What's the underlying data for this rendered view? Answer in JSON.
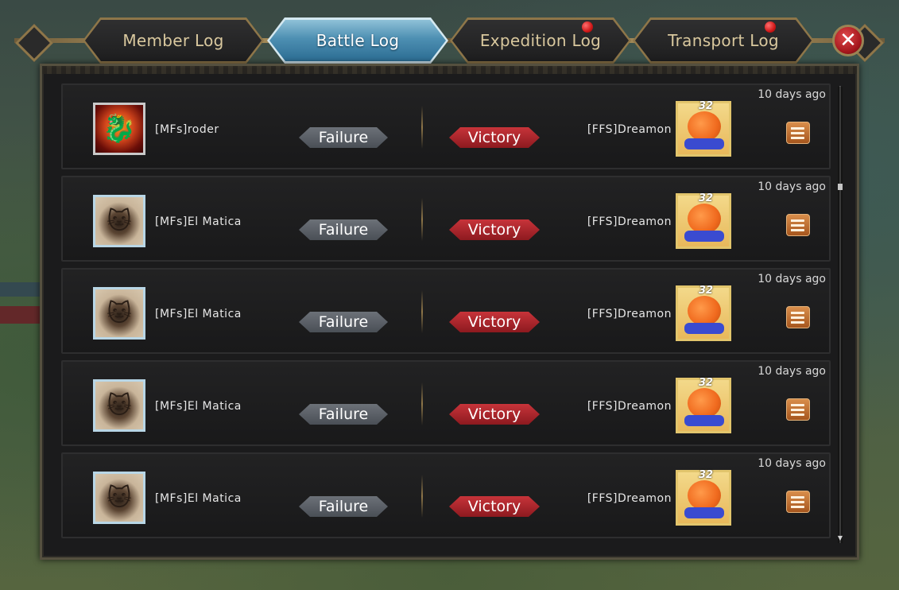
{
  "tabs": [
    {
      "label": "Member Log",
      "active": false,
      "has_notification": false
    },
    {
      "label": "Battle Log",
      "active": true,
      "has_notification": false
    },
    {
      "label": "Expedition Log",
      "active": false,
      "has_notification": true
    },
    {
      "label": "Transport Log",
      "active": false,
      "has_notification": true
    }
  ],
  "close_label": "✕",
  "colors": {
    "active_tab": "#4d8fb2",
    "victory": "#c7343a",
    "failure": "#5a5f66",
    "notification": "#d01818",
    "details_button": "#c1742f"
  },
  "battles": [
    {
      "attacker": "[MFs]roder",
      "attacker_avatar": "dragon",
      "attacker_result": "Failure",
      "defender_result": "Victory",
      "defender": "[FFS]Dreamon",
      "defender_level": "32",
      "time": "10 days ago"
    },
    {
      "attacker": "[MFs]El Matica",
      "attacker_avatar": "cat",
      "attacker_result": "Failure",
      "defender_result": "Victory",
      "defender": "[FFS]Dreamon",
      "defender_level": "32",
      "time": "10 days ago"
    },
    {
      "attacker": "[MFs]El Matica",
      "attacker_avatar": "cat",
      "attacker_result": "Failure",
      "defender_result": "Victory",
      "defender": "[FFS]Dreamon",
      "defender_level": "32",
      "time": "10 days ago"
    },
    {
      "attacker": "[MFs]El Matica",
      "attacker_avatar": "cat",
      "attacker_result": "Failure",
      "defender_result": "Victory",
      "defender": "[FFS]Dreamon",
      "defender_level": "32",
      "time": "10 days ago"
    },
    {
      "attacker": "[MFs]El Matica",
      "attacker_avatar": "cat",
      "attacker_result": "Failure",
      "defender_result": "Victory",
      "defender": "[FFS]Dreamon",
      "defender_level": "32",
      "time": "10 days ago"
    }
  ]
}
